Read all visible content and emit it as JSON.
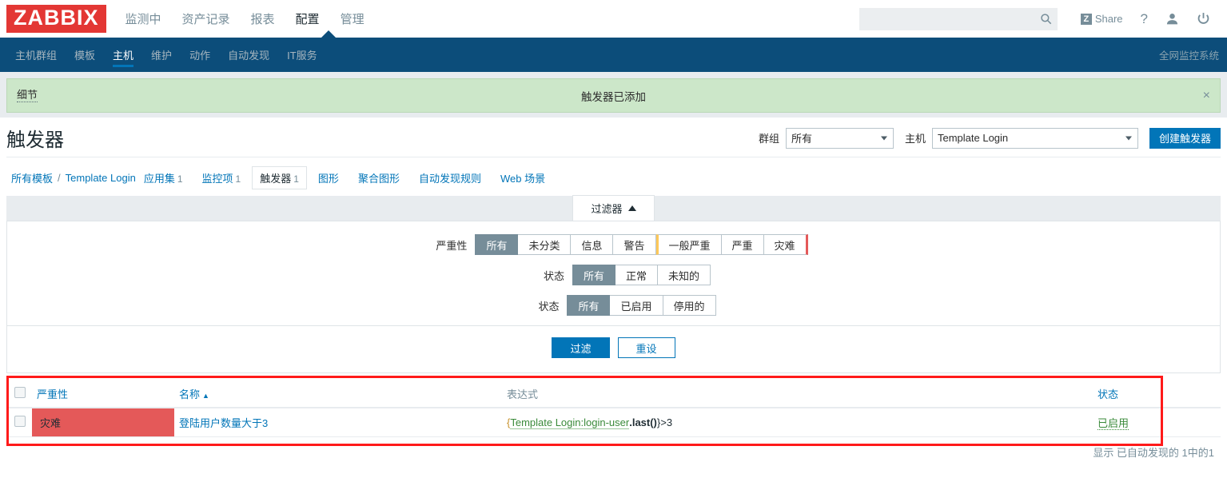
{
  "header": {
    "logo": "ZABBIX",
    "nav": [
      {
        "label": "监测中",
        "selected": false
      },
      {
        "label": "资产记录",
        "selected": false
      },
      {
        "label": "报表",
        "selected": false
      },
      {
        "label": "配置",
        "selected": true
      },
      {
        "label": "管理",
        "selected": false
      }
    ],
    "search": {
      "value": "",
      "placeholder": ""
    },
    "share_label": "Share",
    "share_badge": "Z",
    "help_label": "?",
    "icons": {
      "search": "search-icon",
      "user": "user-icon",
      "power": "power-icon"
    }
  },
  "subnav": {
    "items": [
      {
        "label": "主机群组",
        "selected": false
      },
      {
        "label": "模板",
        "selected": false
      },
      {
        "label": "主机",
        "selected": true
      },
      {
        "label": "维护",
        "selected": false
      },
      {
        "label": "动作",
        "selected": false
      },
      {
        "label": "自动发现",
        "selected": false
      },
      {
        "label": "IT服务",
        "selected": false
      }
    ],
    "right_title": "全网监控系统"
  },
  "message": {
    "details_label": "细节",
    "text": "触发器已添加",
    "close": "×",
    "bg_color": "#cce7c9"
  },
  "page": {
    "title": "触发器",
    "group_label": "群组",
    "group_value": "所有",
    "host_label": "主机",
    "host_value": "Template Login",
    "create_button": "创建触发器"
  },
  "breadcrumb": {
    "all_templates": "所有模板",
    "separator": "/",
    "template_name": "Template Login",
    "tabs": [
      {
        "label": "应用集",
        "count": "1",
        "selected": false
      },
      {
        "label": "监控项",
        "count": "1",
        "selected": false
      },
      {
        "label": "触发器",
        "count": "1",
        "selected": true
      },
      {
        "label": "图形",
        "count": "",
        "selected": false
      },
      {
        "label": "聚合图形",
        "count": "",
        "selected": false
      },
      {
        "label": "自动发现规则",
        "count": "",
        "selected": false
      },
      {
        "label": "Web 场景",
        "count": "",
        "selected": false
      }
    ]
  },
  "filter": {
    "tab_label": "过滤器",
    "tab_arrow": "▲",
    "rows": [
      {
        "label": "严重性",
        "options": [
          {
            "label": "所有",
            "selected": true,
            "accent": ""
          },
          {
            "label": "未分类",
            "selected": false,
            "accent": ""
          },
          {
            "label": "信息",
            "selected": false,
            "accent": ""
          },
          {
            "label": "警告",
            "selected": false,
            "accent": ""
          },
          {
            "label": "一般严重",
            "selected": false,
            "accent": "warning"
          },
          {
            "label": "严重",
            "selected": false,
            "accent": ""
          },
          {
            "label": "灾难",
            "selected": false,
            "accent": "disaster-end"
          }
        ]
      },
      {
        "label": "状态",
        "options": [
          {
            "label": "所有",
            "selected": true,
            "accent": ""
          },
          {
            "label": "正常",
            "selected": false,
            "accent": ""
          },
          {
            "label": "未知的",
            "selected": false,
            "accent": ""
          }
        ]
      },
      {
        "label": "状态",
        "options": [
          {
            "label": "所有",
            "selected": true,
            "accent": ""
          },
          {
            "label": "已启用",
            "selected": false,
            "accent": ""
          },
          {
            "label": "停用的",
            "selected": false,
            "accent": ""
          }
        ]
      }
    ],
    "apply_button": "过滤",
    "reset_button": "重设"
  },
  "table": {
    "headers": {
      "severity": "严重性",
      "name": "名称",
      "sort_arrow": "▲",
      "expression": "表达式",
      "status": "状态"
    },
    "rows": [
      {
        "severity": "灾难",
        "severity_color": "#e45959",
        "name": "登陆用户数量大于3",
        "expression_open": "{",
        "expression_item": "Template Login:login-user",
        "expression_func": ".last()",
        "expression_tail": "}>3",
        "status": "已启用",
        "status_color": "#3a8a3a"
      }
    ],
    "footer": "显示 已自动发现的 1中的1"
  },
  "annotation": {
    "color": "#ff1a1a"
  }
}
